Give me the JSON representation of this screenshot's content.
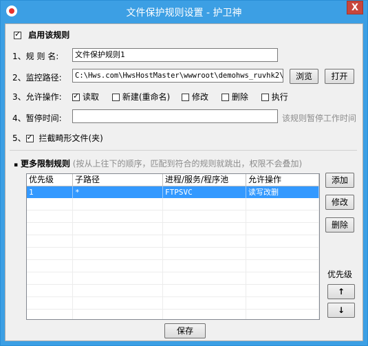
{
  "window": {
    "title": "文件保护规则设置 - 护卫神",
    "close_label": "X"
  },
  "enable": {
    "label": "启用该规则",
    "checked": true
  },
  "rule_name": {
    "label": "1、规 则 名:",
    "value": "文件保护规则1"
  },
  "monitor_path": {
    "label": "2、监控路径:",
    "value": "C:\\Hws.com\\HwsHostMaster\\wwwroot\\demohws_ruvhk2\\*",
    "browse_label": "浏览",
    "open_label": "打开"
  },
  "allowed_ops": {
    "label": "3、允许操作:",
    "options": [
      {
        "label": "读取",
        "checked": true
      },
      {
        "label": "新建(重命名)",
        "checked": false
      },
      {
        "label": "修改",
        "checked": false
      },
      {
        "label": "删除",
        "checked": false
      },
      {
        "label": "执行",
        "checked": false
      }
    ]
  },
  "pause_time": {
    "label": "4、暂停时间:",
    "value": "",
    "hint": "该规则暂停工作时间"
  },
  "block_deformed": {
    "prefix": "5、",
    "label": "拦截畸形文件(夹)",
    "checked": true
  },
  "more_rules": {
    "title": "更多限制规则",
    "hint": "(按从上往下的顺序，匹配到符合的规则就跳出，权限不会叠加)",
    "columns": [
      "优先级",
      "子路径",
      "进程/服务/程序池",
      "允许操作"
    ],
    "rows": [
      {
        "priority": "1",
        "subpath": "*",
        "process": "FTPSVC",
        "ops": "读写改删"
      }
    ],
    "add_label": "添加",
    "edit_label": "修改",
    "delete_label": "删除",
    "priority_label": "优先级",
    "up_label": "↑",
    "down_label": "↓"
  },
  "save_label": "保存"
}
